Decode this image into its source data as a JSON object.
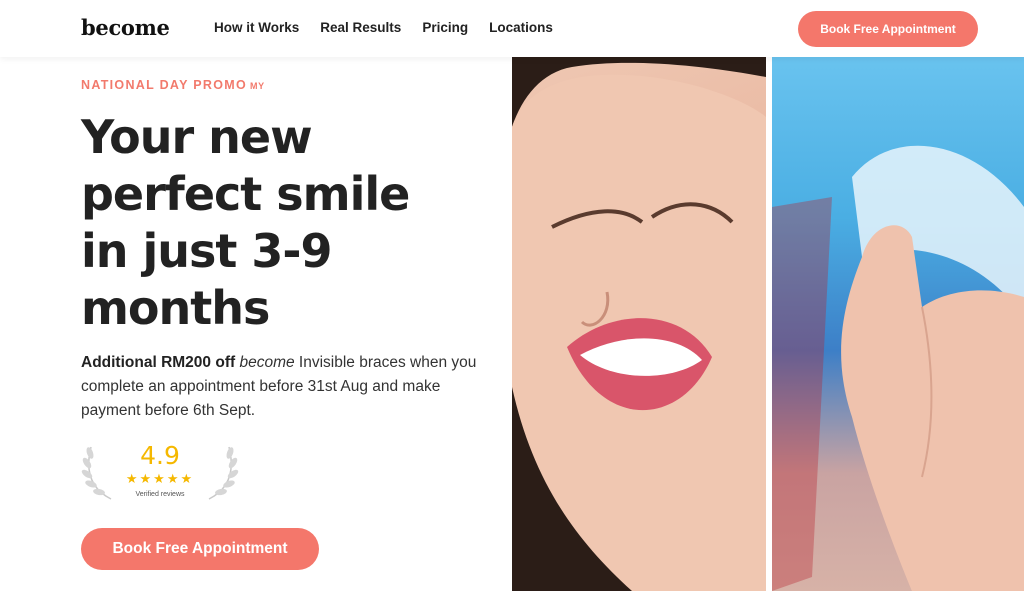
{
  "brand": {
    "logo_text": "become"
  },
  "nav": {
    "items": [
      {
        "label": "How it Works"
      },
      {
        "label": "Real Results"
      },
      {
        "label": "Pricing"
      },
      {
        "label": "Locations"
      }
    ],
    "cta_label": "Book Free Appointment"
  },
  "hero": {
    "promo_label": "NATIONAL DAY PROMO",
    "promo_tag": "MY",
    "headline_lines": [
      "Your new",
      "perfect smile",
      "in just 3-9",
      "months"
    ],
    "sub_bold": "Additional RM200 off",
    "sub_italic": "become",
    "sub_rest": " Invisible braces when you complete an appointment before 31st Aug and make payment before 6th Sept.",
    "rating_score": "4.9",
    "rating_stars": "★★★★★",
    "rating_caption": "Verified reviews",
    "cta_label": "Book Free Appointment"
  },
  "images": {
    "left": {
      "icon": "smiling-woman-photo"
    },
    "right": {
      "icon": "hand-holding-aligner-photo"
    }
  },
  "colors": {
    "accent": "#f4776b",
    "star": "#f5b800",
    "text": "#222222"
  }
}
